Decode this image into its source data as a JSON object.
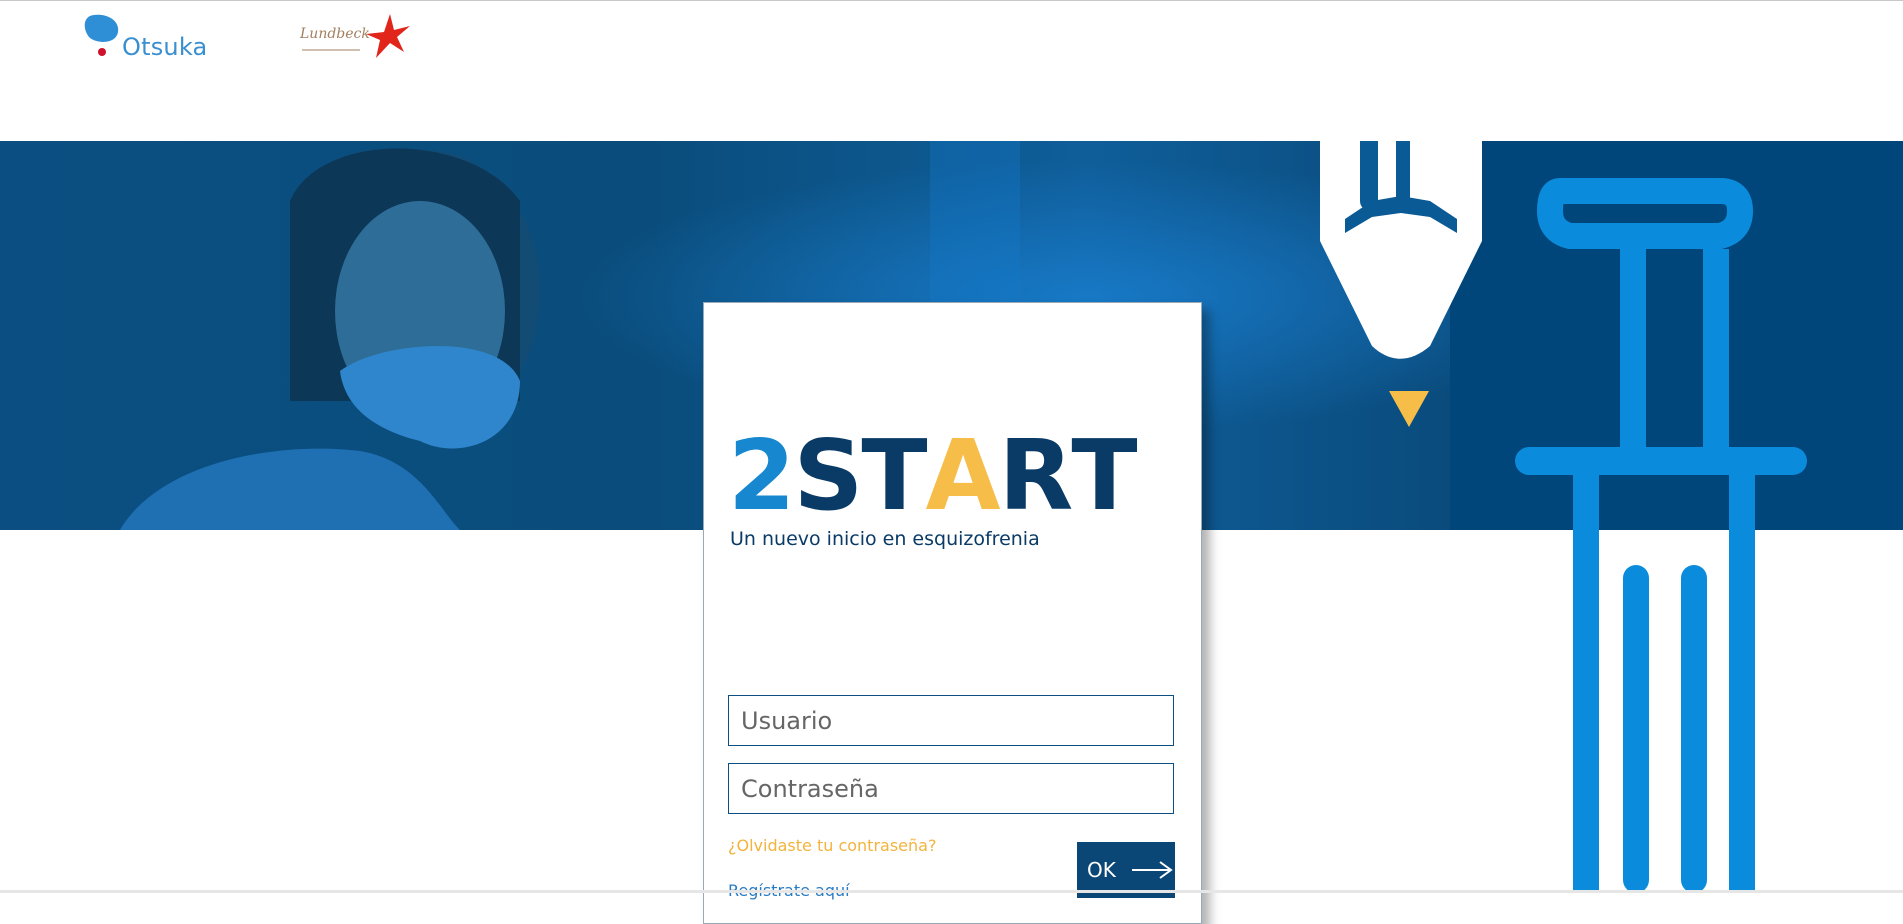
{
  "header": {
    "otsuka_logo_text": "Otsuka",
    "lundbeck_logo_text": "Lundbeck"
  },
  "login": {
    "brand_letters": [
      {
        "char": "2",
        "color": "#1787d0"
      },
      {
        "char": "S",
        "color": "#0a3b66"
      },
      {
        "char": "T",
        "color": "#0a3b66"
      },
      {
        "char": "A",
        "color": "#f6bd49"
      },
      {
        "char": "R",
        "color": "#0a3b66"
      },
      {
        "char": "T",
        "color": "#0a3b66"
      }
    ],
    "tagline": "Un nuevo inicio en esquizofrenia",
    "username": {
      "placeholder": "Usuario",
      "value": ""
    },
    "password": {
      "placeholder": "Contraseña",
      "value": ""
    },
    "forgot_link": "¿Olvidaste tu contraseña?",
    "register_link": "Regístrate aquí",
    "ok_label": "OK"
  },
  "colors": {
    "primary_dark": "#0a3b66",
    "primary_blue": "#1787d0",
    "accent_yellow": "#f6bd49",
    "hero_background": "#0d4f80"
  },
  "icons": [
    "otsuka-logo-icon",
    "lundbeck-starfish-icon",
    "pencil-icon",
    "column-icon",
    "arrow-right-icon"
  ]
}
